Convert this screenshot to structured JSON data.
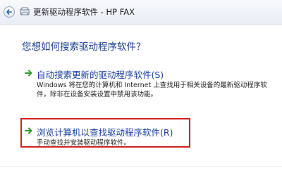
{
  "window": {
    "title": "更新驱动程序软件 - HP FAX"
  },
  "question": "您想如何搜索驱动程序软件？",
  "options": [
    {
      "title": "自动搜索更新的驱动程序软件(S)",
      "description": "Windows 将在您的计算机和 Internet 上查找用于相关设备的最新驱动程序软件，除非在设备安装设置中禁用该功能。"
    },
    {
      "title": "浏览计算机以查找驱动程序软件(R)",
      "description": "手动查找并安装驱动程序软件。"
    }
  ],
  "icons": {
    "back": "back-arrow-icon",
    "app": "device-icon",
    "option_arrow": "green-arrow-icon"
  },
  "colors": {
    "accent_blue": "#1b3fa0",
    "arrow_green": "#2f9a2f",
    "highlight_red": "#d12020"
  }
}
